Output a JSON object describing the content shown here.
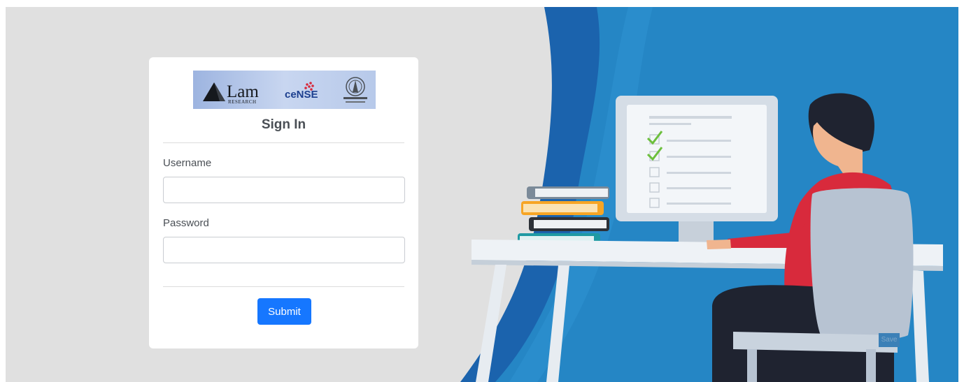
{
  "logos": {
    "lam_name": "Lam",
    "lam_sub": "RESEARCH",
    "cense": "ceNSE"
  },
  "form": {
    "title": "Sign In",
    "username_label": "Username",
    "username_value": "",
    "password_label": "Password",
    "password_value": "",
    "submit_label": "Submit"
  },
  "illustration": {
    "ghost_button_label": "Save"
  },
  "colors": {
    "page_background": "#e0e0e0",
    "accent_blue": "#1677ff",
    "illustration_blue": "#2586c5",
    "shirt_red": "#d82a3c"
  },
  "icons": [
    "lam-logo-icon",
    "cense-logo-icon",
    "iisc-emblem-icon",
    "checkmark-icon",
    "checkbox-icon"
  ]
}
